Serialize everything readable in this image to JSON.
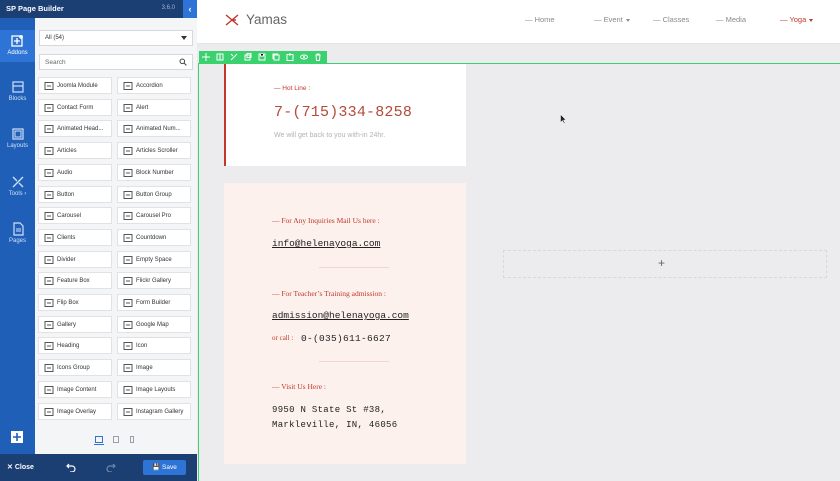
{
  "builder": {
    "title": "SP Page Builder",
    "version": "3.6.0",
    "rail": [
      {
        "label": "Addons",
        "icon": "plus-square-icon"
      },
      {
        "label": "Blocks",
        "icon": "blocks-icon"
      },
      {
        "label": "Layouts",
        "icon": "layouts-icon"
      },
      {
        "label": "Tools ›",
        "icon": "tools-icon"
      },
      {
        "label": "Pages",
        "icon": "page-icon"
      }
    ],
    "filter_value": "All (54)",
    "search_placeholder": "Search",
    "addons": [
      "Joomla Module",
      "Accordion",
      "Contact Form",
      "Alert",
      "Animated Head...",
      "Animated Num...",
      "Articles",
      "Articles Scroller",
      "Audio",
      "Block Number",
      "Button",
      "Button Group",
      "Carousel",
      "Carousel Pro",
      "Clients",
      "Countdown",
      "Divider",
      "Empty Space",
      "Feature Box",
      "Flickr Gallery",
      "Flip Box",
      "Form Builder",
      "Gallery",
      "Google Map",
      "Heading",
      "Icon",
      "Icons Group",
      "Image",
      "Image Content",
      "Image Layouts",
      "Image Overlay",
      "Instagram Gallery"
    ],
    "close_label": "Close",
    "save_label": "Save"
  },
  "site": {
    "logo": "Yamas",
    "nav": [
      {
        "label": "— Home",
        "dropdown": false,
        "active": false
      },
      {
        "label": "— Event",
        "dropdown": true,
        "active": false
      },
      {
        "label": "— Classes",
        "dropdown": false,
        "active": false
      },
      {
        "label": "— Media",
        "dropdown": false,
        "active": false
      },
      {
        "label": "— Yoga",
        "dropdown": true,
        "active": true
      }
    ],
    "hotline": {
      "label": "— Hot Line :",
      "phone": "7-(715)334-8258",
      "note": "We will get back to you with-in 24hr."
    },
    "contact": {
      "inquiries_label": "— For Any Inquiries Mail Us here :",
      "inquiries_email": "info@helenayoga.com",
      "training_label": "— For Teacher’s Training admission :",
      "training_email": "admission@helenayoga.com",
      "call_label": "or call :",
      "call_phone": "0-(035)611-6627",
      "visit_label": "— Visit Us Here :",
      "address_line1": "9950 N State St #38,",
      "address_line2": "Markleville, IN, 46056"
    },
    "empty_column_symbol": "+"
  },
  "colors": {
    "rail_blue": "#1f5fb8",
    "header_navy": "#1b3e73",
    "accent_red": "#c0392b",
    "builder_green": "#3bd16f",
    "card_pink": "#fdf1ed"
  }
}
